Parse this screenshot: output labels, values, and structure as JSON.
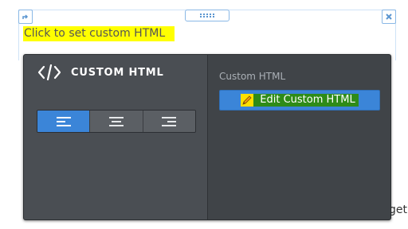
{
  "widget": {
    "placeholder_text": "Click to set custom HTML",
    "background_text": "get"
  },
  "panel": {
    "title": "CUSTOM HTML",
    "title_icon": "code-icon",
    "alignment": {
      "options": [
        "align-left",
        "align-center",
        "align-right"
      ],
      "selected": "align-left"
    },
    "section_label": "Custom HTML",
    "edit_button_label": "Edit Custom HTML",
    "edit_button_icon": "pencil-icon"
  },
  "colors": {
    "panel_bg": "#404448",
    "panel_left_bg": "#4a4e53",
    "accent_blue": "#3b85d8",
    "highlight_yellow": "#ffff00",
    "frame_blue": "#8ab8e6"
  }
}
